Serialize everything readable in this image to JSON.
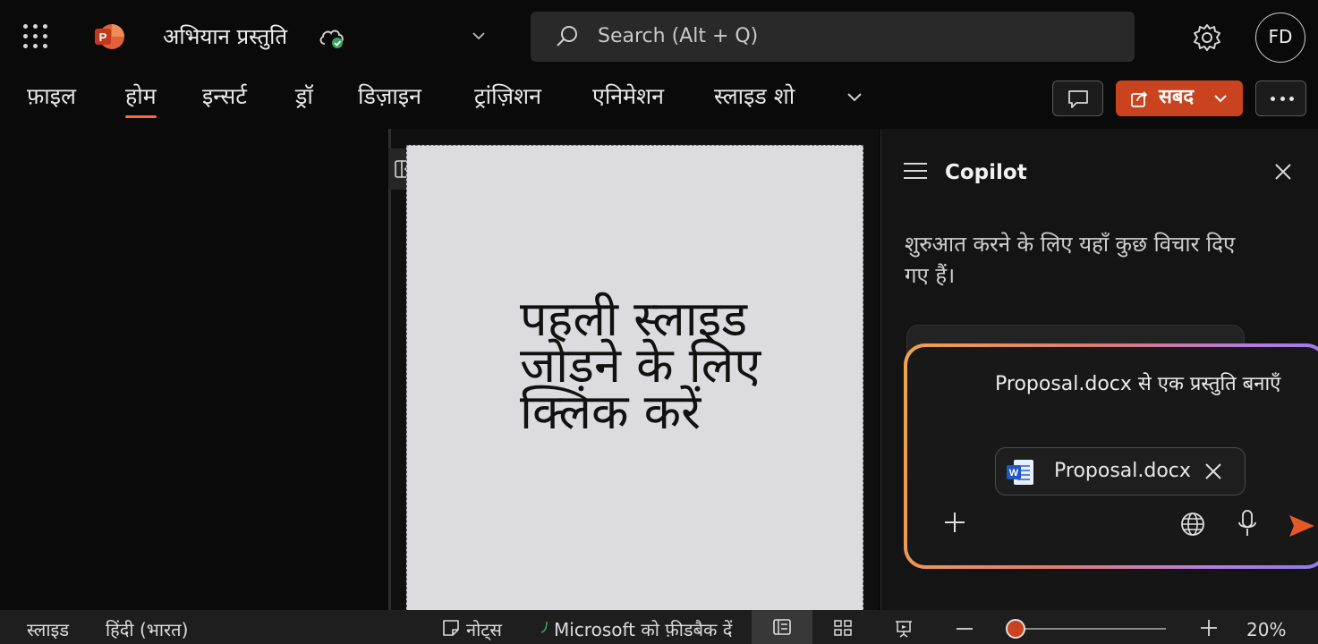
{
  "header": {
    "document_title": "अभियान प्रस्तुति",
    "search_placeholder": "Search (Alt + Q)",
    "avatar_initials": "FD"
  },
  "ribbon": {
    "tabs": [
      {
        "label": "फ़ाइल",
        "active": false
      },
      {
        "label": "होम",
        "active": true
      },
      {
        "label": "इन्सर्ट",
        "active": false
      },
      {
        "label": "ड्रॉ",
        "active": false
      },
      {
        "label": "डिज़ाइन",
        "active": false
      },
      {
        "label": "ट्रांज़िशन",
        "active": false
      },
      {
        "label": "एनिमेशन",
        "active": false
      },
      {
        "label": "स्लाइड शो",
        "active": false
      }
    ],
    "share_label": "सबद"
  },
  "slide": {
    "placeholder_text": "पहली स्लाइड जोड़ने के लिए क्लिक करें"
  },
  "copilot": {
    "title": "Copilot",
    "intro": "शुरुआत करने के लिए यहाँ कुछ विचार दिए गए हैं।",
    "prompt_text": "Proposal.docx से एक प्रस्तुति बनाएँ",
    "attachment_name": "Proposal.docx"
  },
  "statusbar": {
    "slide_label": "स्लाइड",
    "language": "हिंदी (भारत)",
    "notes_label": "नोट्स",
    "feedback_label": "Microsoft को फ़ीडबैक दें",
    "zoom_percent": "20%"
  },
  "colors": {
    "accent": "#c8431e",
    "tab_underline": "#ff6a3d",
    "background": "#0a0a0a",
    "slide_background": "#dcdce0"
  }
}
